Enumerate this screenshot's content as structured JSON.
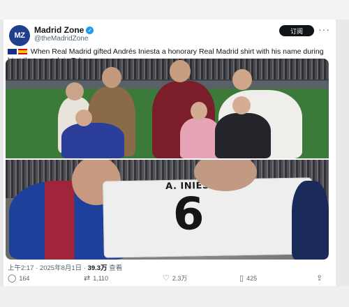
{
  "tweet": {
    "author_name": "Madrid Zone",
    "handle": "@theMadridZone",
    "avatar_text": "MZ",
    "follow_label": "订阅",
    "text": "When Real Madrid gifted Andrés Iniesta a honorary Real Madrid shirt with his name during his tribute match in Tokyo.",
    "timestamp": "上午2:17 · 2025年8月1日 · ",
    "views_count": "39.3万",
    "views_label": " 查看"
  },
  "photo": {
    "jersey_name": "A. INIESTA",
    "jersey_number": "6"
  },
  "actions": {
    "replies": "164",
    "reposts": "1,110",
    "likes": "2.3万",
    "bookmarks": "425"
  },
  "icons": [
    "verified-icon",
    "more-icon",
    "reply-icon",
    "repost-icon",
    "like-icon",
    "bookmark-icon",
    "share-icon"
  ],
  "colors": {
    "accent": "#1d9bf0",
    "text": "#0f1419",
    "muted": "#536471"
  }
}
